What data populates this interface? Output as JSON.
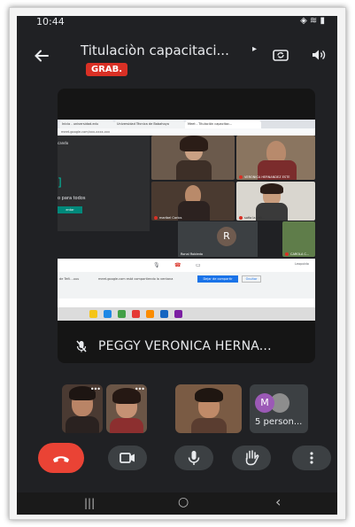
{
  "status_bar": {
    "time": "10:44",
    "right_icons": "◈ ≋ ▮"
  },
  "header": {
    "back_icon": "arrow-back-icon",
    "title": "Titulaciòn capacitaci...",
    "title_chevron": "▸",
    "recording_badge": "GRAB.",
    "camera_switch_icon": "camera-switch-icon",
    "speaker_icon": "speaker-icon"
  },
  "main_tile": {
    "participant_name": "PEGGY VERONICA HERNA...",
    "mic_state": "muted",
    "shared_screen": {
      "tabs": [
        "Inicio - universidad.edu",
        "Universidad Técnica de Babahoyo",
        "Meet - Titulación capacitac..."
      ],
      "url_text": "meet.google.com/xxx-xxxx-xxx",
      "presenting_panel": {
        "title": "cando",
        "line": "o para todos",
        "button": "entar"
      },
      "video_tiles": [
        {
          "label": ""
        },
        {
          "label": "VERONICA HERNANDEZ ESTE"
        },
        {
          "label": "maribel Carlos"
        },
        {
          "label": "sofia la veli..."
        },
        {
          "label": "Ronal Robledo"
        },
        {
          "label": "CAROLA C..."
        }
      ],
      "r_avatar": "R",
      "share_banner": {
        "text_left": "de Teñi...uuu",
        "text_mid": "meet.google.com está compartiendo la ventana",
        "stop_button": "Dejar de compartir",
        "hide_button": "Ocultar"
      },
      "side_label": "Leopoldo"
    }
  },
  "thumbnails": [
    {
      "name": "participant-1",
      "has_menu": true
    },
    {
      "name": "participant-2",
      "has_menu": true
    },
    {
      "name": "participant-3",
      "has_menu": false
    }
  ],
  "people_tile": {
    "avatar_letter": "M",
    "label": "5 person..."
  },
  "controls": {
    "end_call_icon": "end-call-icon",
    "camera_icon": "video-camera-icon",
    "mic_icon": "microphone-icon",
    "hand_icon": "raise-hand-icon",
    "more_icon": "more-vertical-icon"
  },
  "nav": {
    "recents": "|||",
    "home": "○",
    "back": "‹"
  },
  "colors": {
    "record_red": "#d93025",
    "end_call_red": "#ea4335",
    "surface": "#202124",
    "control_gray": "#3c4043"
  }
}
